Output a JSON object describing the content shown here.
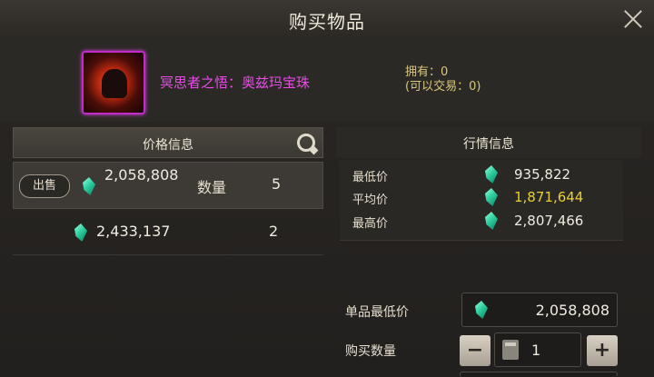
{
  "title": "购买物品",
  "item": {
    "name": "冥思者之悟：奥兹玛宝珠",
    "own_line1": "拥有：0",
    "own_line2": "(可以交易：0)"
  },
  "price_info": {
    "header": "价格信息",
    "listings": [
      {
        "action": "出售",
        "price": "2,058,808",
        "qty_label": "数量",
        "qty": "5"
      },
      {
        "price": "2,433,137",
        "qty": "2"
      }
    ]
  },
  "market_info": {
    "header": "行情信息",
    "rows": [
      {
        "label": "最低价",
        "value": "935,822"
      },
      {
        "label": "平均价",
        "value": "1,871,644"
      },
      {
        "label": "最高价",
        "value": "2,807,466"
      }
    ]
  },
  "purchase": {
    "unit_min_label": "单品最低价",
    "unit_min_value": "2,058,808",
    "qty_label": "购买数量",
    "qty_value": "1",
    "minus": "−",
    "plus": "+"
  },
  "colors": {
    "item_name": "#e84be8",
    "average_price": "#e8d030",
    "currency_gem": "#2fd0a0"
  }
}
